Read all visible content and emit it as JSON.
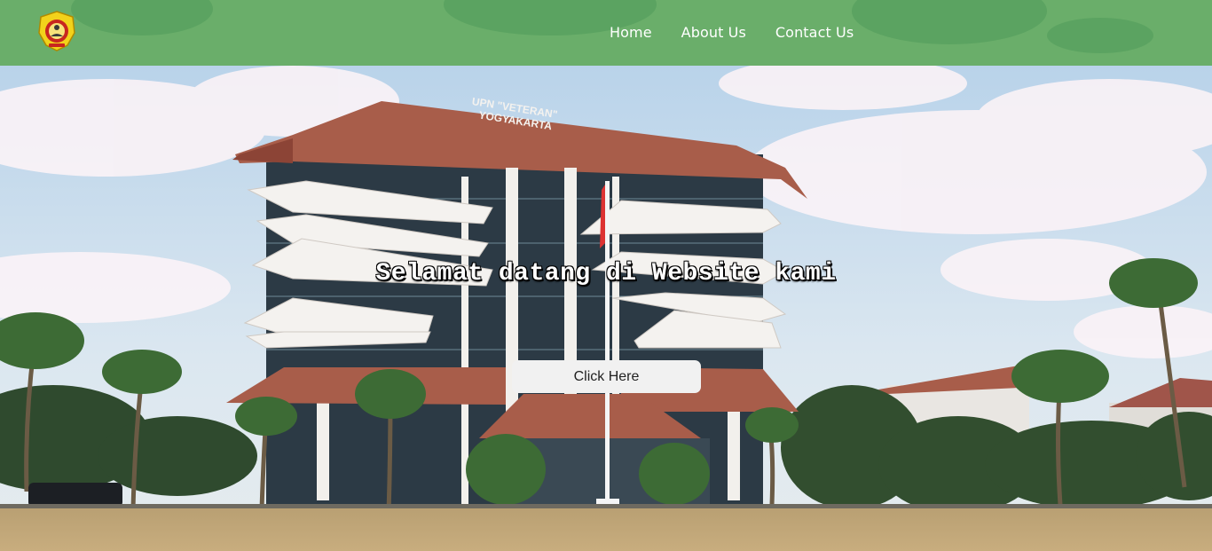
{
  "header": {
    "logo_icon": "university-emblem-icon",
    "nav": [
      {
        "label": "Home"
      },
      {
        "label": "About Us"
      },
      {
        "label": "Contact Us"
      }
    ]
  },
  "hero": {
    "building_sign_line1": "UPN \"VETERAN\"",
    "building_sign_line2": "YOGYAKARTA",
    "title": "Selamat datang di Website kami",
    "button_label": "Click Here"
  },
  "colors": {
    "header_bg": "#6aae6a",
    "nav_text": "#ffffff",
    "button_bg": "#f1f1f1",
    "roof": "#a85d4a"
  }
}
